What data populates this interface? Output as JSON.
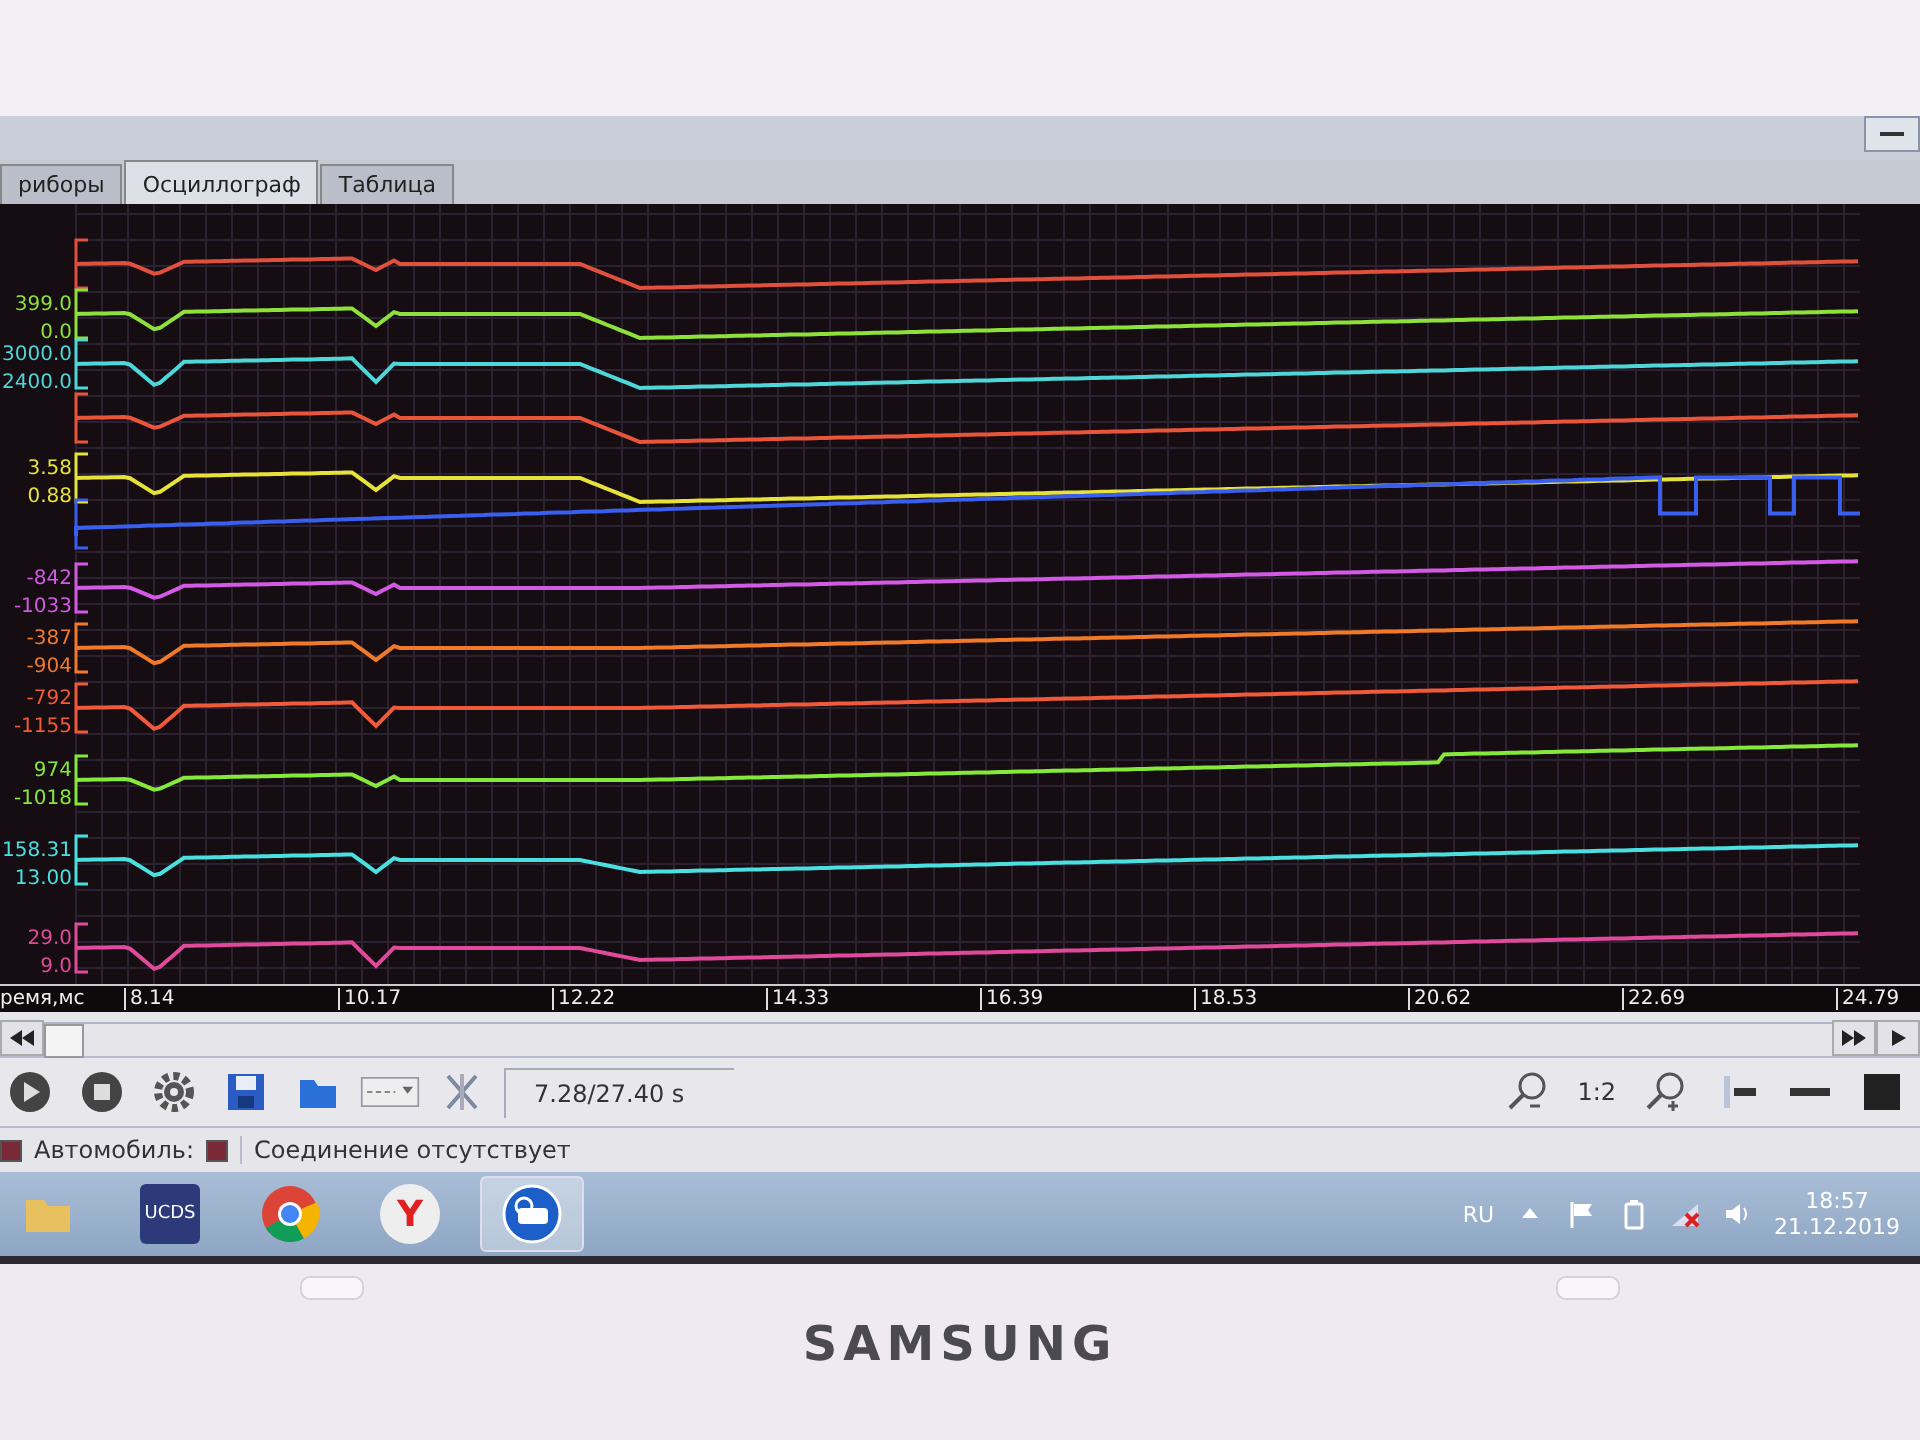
{
  "tabs": [
    {
      "label": "риборы",
      "selected": false
    },
    {
      "label": "Осциллограф",
      "selected": true
    },
    {
      "label": "Таблица",
      "selected": false
    }
  ],
  "channels": [
    {
      "kind": "wave",
      "color": "#e0503c"
    },
    {
      "kind": "wave",
      "color": "#8ee03a",
      "max": "399.0",
      "min": "0.0"
    },
    {
      "kind": "wave",
      "color": "#4fd6d8",
      "max": "3000.0",
      "min": "2400.0"
    },
    {
      "kind": "wave",
      "color": "#e8553a"
    },
    {
      "kind": "wave",
      "color": "#e6e23a",
      "max": "3.58",
      "min": "0.88"
    },
    {
      "kind": "pulse",
      "color": "#3a5ef0"
    },
    {
      "kind": "wave",
      "color": "#d45ae6",
      "max": "-842",
      "min": "-1033"
    },
    {
      "kind": "wave",
      "color": "#f07a2a",
      "max": "-387",
      "min": "-904"
    },
    {
      "kind": "wave",
      "color": "#f05a3a",
      "max": "-792",
      "min": "-1155"
    },
    {
      "kind": "wave",
      "color": "#86e83a",
      "max": "974",
      "min": "-1018"
    },
    {
      "kind": "wave",
      "color": "#4ae0e0",
      "max": "158.31",
      "min": "13.00"
    },
    {
      "kind": "wave",
      "color": "#e04a9a",
      "max": "29.0",
      "min": "9.0"
    }
  ],
  "time_axis": {
    "label": "ремя,мс",
    "ticks": [
      "8.14",
      "10.17",
      "12.22",
      "14.33",
      "16.39",
      "18.53",
      "20.62",
      "22.69",
      "24.79"
    ]
  },
  "toolbar": {
    "time_reading": "7.28/27.40 s",
    "zoom_ratio": "1:2"
  },
  "status_bar": {
    "car_label": "Автомобиль:",
    "connection": "Соединение отсутствует"
  },
  "taskbar": {
    "apps": [
      {
        "kind": "folder"
      },
      {
        "kind": "ucds",
        "label": "UCDS"
      },
      {
        "kind": "chrome"
      },
      {
        "kind": "yandex",
        "label": "Y"
      },
      {
        "kind": "scope",
        "selected": true
      }
    ],
    "language": "RU",
    "time": "18:57",
    "date": "21.12.2019"
  },
  "bezel": {
    "brand": "SAMSUNG"
  }
}
